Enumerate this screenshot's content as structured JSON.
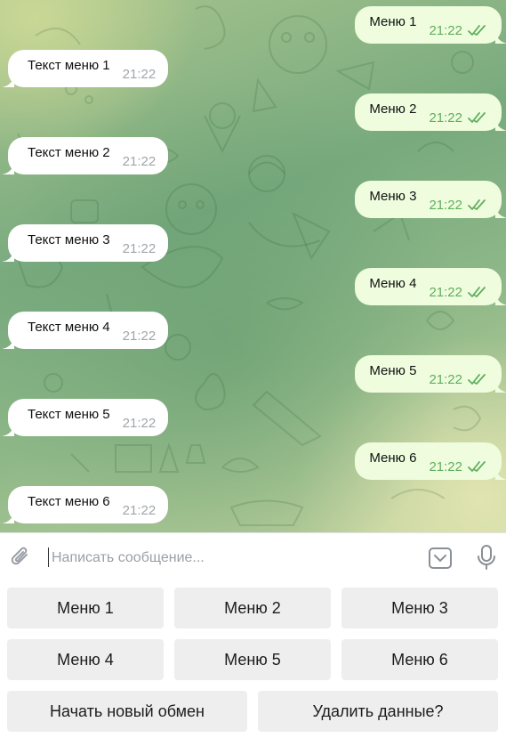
{
  "messages": [
    {
      "dir": "out",
      "text": "Меню 1",
      "time": "21:22"
    },
    {
      "dir": "in",
      "text": "Текст меню 1",
      "time": "21:22"
    },
    {
      "dir": "out",
      "text": "Меню 2",
      "time": "21:22"
    },
    {
      "dir": "in",
      "text": "Текст меню 2",
      "time": "21:22"
    },
    {
      "dir": "out",
      "text": "Меню 3",
      "time": "21:22"
    },
    {
      "dir": "in",
      "text": "Текст меню 3",
      "time": "21:22"
    },
    {
      "dir": "out",
      "text": "Меню 4",
      "time": "21:22"
    },
    {
      "dir": "in",
      "text": "Текст меню 4",
      "time": "21:22"
    },
    {
      "dir": "out",
      "text": "Меню 5",
      "time": "21:22"
    },
    {
      "dir": "in",
      "text": "Текст меню 5",
      "time": "21:22"
    },
    {
      "dir": "out",
      "text": "Меню 6",
      "time": "21:22"
    },
    {
      "dir": "in",
      "text": "Текст меню 6",
      "time": "21:22"
    }
  ],
  "composer": {
    "placeholder": "Написать сообщение...",
    "value": "",
    "icons": {
      "attach": "paperclip-icon",
      "keyboard": "keyboard-toggle-icon",
      "mic": "microphone-icon"
    }
  },
  "keyboard": {
    "rows": [
      [
        "Меню 1",
        "Меню 2",
        "Меню 3"
      ],
      [
        "Меню 4",
        "Меню 5",
        "Меню 6"
      ],
      [
        "Начать новый обмен",
        "Удалить данные?"
      ]
    ]
  },
  "colors": {
    "outgoing_bubble": "#effdde",
    "incoming_bubble": "#ffffff",
    "read_check": "#5fae5c",
    "time_incoming": "#a0a6aa",
    "keyboard_button": "#eeeeee"
  }
}
